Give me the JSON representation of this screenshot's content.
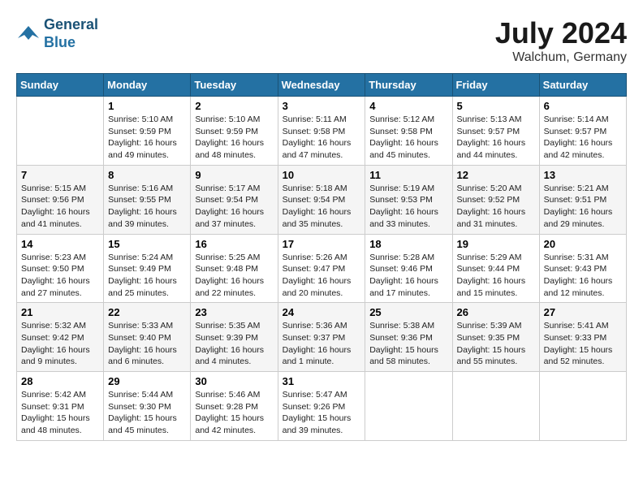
{
  "header": {
    "logo_line1": "General",
    "logo_line2": "Blue",
    "title": "July 2024",
    "location": "Walchum, Germany"
  },
  "days_of_week": [
    "Sunday",
    "Monday",
    "Tuesday",
    "Wednesday",
    "Thursday",
    "Friday",
    "Saturday"
  ],
  "weeks": [
    [
      {
        "day": "",
        "sunrise": "",
        "sunset": "",
        "daylight": ""
      },
      {
        "day": "1",
        "sunrise": "5:10 AM",
        "sunset": "9:59 PM",
        "daylight": "16 hours and 49 minutes."
      },
      {
        "day": "2",
        "sunrise": "5:10 AM",
        "sunset": "9:59 PM",
        "daylight": "16 hours and 48 minutes."
      },
      {
        "day": "3",
        "sunrise": "5:11 AM",
        "sunset": "9:58 PM",
        "daylight": "16 hours and 47 minutes."
      },
      {
        "day": "4",
        "sunrise": "5:12 AM",
        "sunset": "9:58 PM",
        "daylight": "16 hours and 45 minutes."
      },
      {
        "day": "5",
        "sunrise": "5:13 AM",
        "sunset": "9:57 PM",
        "daylight": "16 hours and 44 minutes."
      },
      {
        "day": "6",
        "sunrise": "5:14 AM",
        "sunset": "9:57 PM",
        "daylight": "16 hours and 42 minutes."
      }
    ],
    [
      {
        "day": "7",
        "sunrise": "5:15 AM",
        "sunset": "9:56 PM",
        "daylight": "16 hours and 41 minutes."
      },
      {
        "day": "8",
        "sunrise": "5:16 AM",
        "sunset": "9:55 PM",
        "daylight": "16 hours and 39 minutes."
      },
      {
        "day": "9",
        "sunrise": "5:17 AM",
        "sunset": "9:54 PM",
        "daylight": "16 hours and 37 minutes."
      },
      {
        "day": "10",
        "sunrise": "5:18 AM",
        "sunset": "9:54 PM",
        "daylight": "16 hours and 35 minutes."
      },
      {
        "day": "11",
        "sunrise": "5:19 AM",
        "sunset": "9:53 PM",
        "daylight": "16 hours and 33 minutes."
      },
      {
        "day": "12",
        "sunrise": "5:20 AM",
        "sunset": "9:52 PM",
        "daylight": "16 hours and 31 minutes."
      },
      {
        "day": "13",
        "sunrise": "5:21 AM",
        "sunset": "9:51 PM",
        "daylight": "16 hours and 29 minutes."
      }
    ],
    [
      {
        "day": "14",
        "sunrise": "5:23 AM",
        "sunset": "9:50 PM",
        "daylight": "16 hours and 27 minutes."
      },
      {
        "day": "15",
        "sunrise": "5:24 AM",
        "sunset": "9:49 PM",
        "daylight": "16 hours and 25 minutes."
      },
      {
        "day": "16",
        "sunrise": "5:25 AM",
        "sunset": "9:48 PM",
        "daylight": "16 hours and 22 minutes."
      },
      {
        "day": "17",
        "sunrise": "5:26 AM",
        "sunset": "9:47 PM",
        "daylight": "16 hours and 20 minutes."
      },
      {
        "day": "18",
        "sunrise": "5:28 AM",
        "sunset": "9:46 PM",
        "daylight": "16 hours and 17 minutes."
      },
      {
        "day": "19",
        "sunrise": "5:29 AM",
        "sunset": "9:44 PM",
        "daylight": "16 hours and 15 minutes."
      },
      {
        "day": "20",
        "sunrise": "5:31 AM",
        "sunset": "9:43 PM",
        "daylight": "16 hours and 12 minutes."
      }
    ],
    [
      {
        "day": "21",
        "sunrise": "5:32 AM",
        "sunset": "9:42 PM",
        "daylight": "16 hours and 9 minutes."
      },
      {
        "day": "22",
        "sunrise": "5:33 AM",
        "sunset": "9:40 PM",
        "daylight": "16 hours and 6 minutes."
      },
      {
        "day": "23",
        "sunrise": "5:35 AM",
        "sunset": "9:39 PM",
        "daylight": "16 hours and 4 minutes."
      },
      {
        "day": "24",
        "sunrise": "5:36 AM",
        "sunset": "9:37 PM",
        "daylight": "16 hours and 1 minute."
      },
      {
        "day": "25",
        "sunrise": "5:38 AM",
        "sunset": "9:36 PM",
        "daylight": "15 hours and 58 minutes."
      },
      {
        "day": "26",
        "sunrise": "5:39 AM",
        "sunset": "9:35 PM",
        "daylight": "15 hours and 55 minutes."
      },
      {
        "day": "27",
        "sunrise": "5:41 AM",
        "sunset": "9:33 PM",
        "daylight": "15 hours and 52 minutes."
      }
    ],
    [
      {
        "day": "28",
        "sunrise": "5:42 AM",
        "sunset": "9:31 PM",
        "daylight": "15 hours and 48 minutes."
      },
      {
        "day": "29",
        "sunrise": "5:44 AM",
        "sunset": "9:30 PM",
        "daylight": "15 hours and 45 minutes."
      },
      {
        "day": "30",
        "sunrise": "5:46 AM",
        "sunset": "9:28 PM",
        "daylight": "15 hours and 42 minutes."
      },
      {
        "day": "31",
        "sunrise": "5:47 AM",
        "sunset": "9:26 PM",
        "daylight": "15 hours and 39 minutes."
      },
      {
        "day": "",
        "sunrise": "",
        "sunset": "",
        "daylight": ""
      },
      {
        "day": "",
        "sunrise": "",
        "sunset": "",
        "daylight": ""
      },
      {
        "day": "",
        "sunrise": "",
        "sunset": "",
        "daylight": ""
      }
    ]
  ],
  "labels": {
    "sunrise_label": "Sunrise:",
    "sunset_label": "Sunset:",
    "daylight_label": "Daylight:"
  }
}
